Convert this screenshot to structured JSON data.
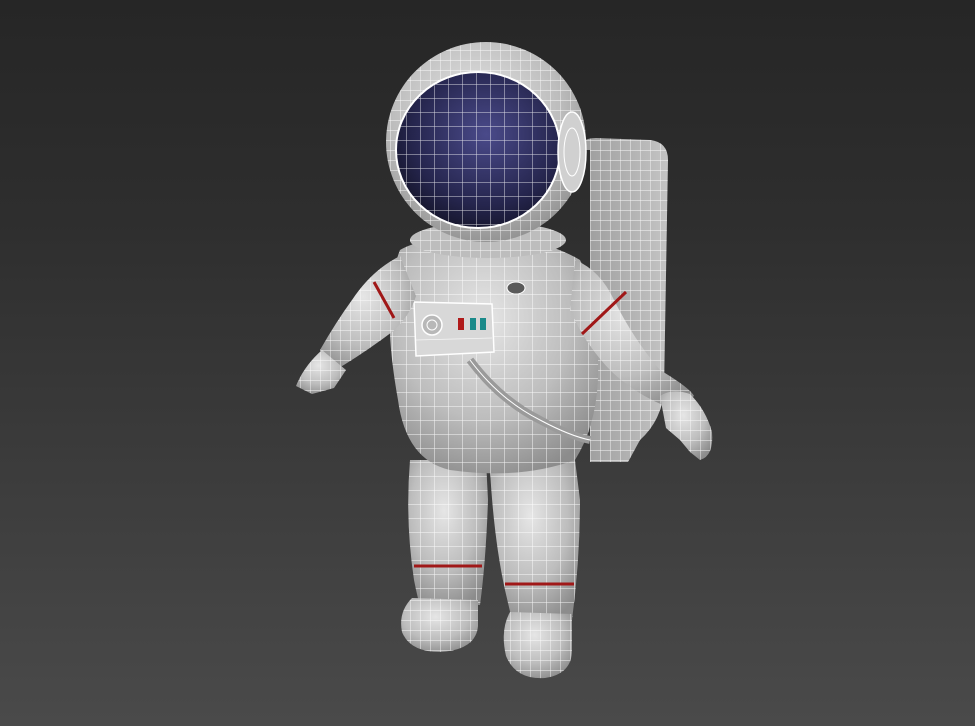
{
  "scene": {
    "subject_icon": "astronaut-wireframe-model",
    "background_top": "#262626",
    "background_bottom": "#4a4a4a",
    "suit_color": "#c9c9c9",
    "visor_color": "#2a2a55",
    "stripe_color": "#a01818",
    "wire_color": "#ffffff",
    "panel_indicator_colors": [
      "#b01a1a",
      "#1a8a8a"
    ]
  }
}
